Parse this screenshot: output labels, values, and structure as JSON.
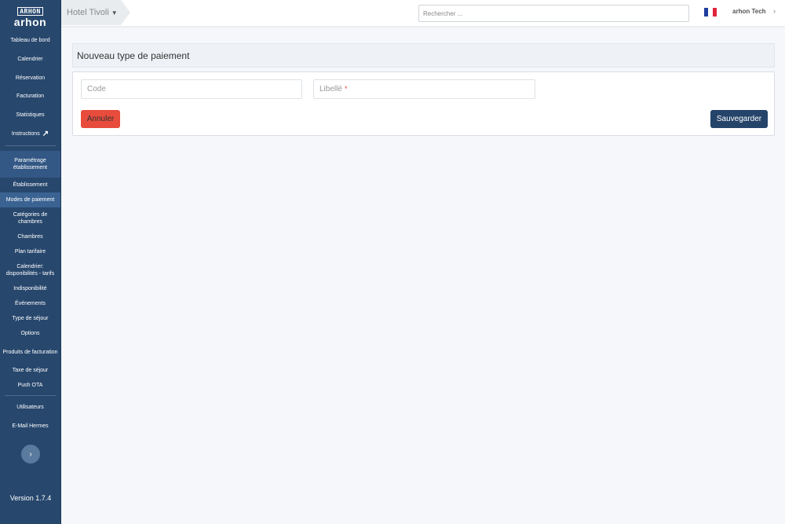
{
  "sidebar": {
    "logo_top": "ARHON",
    "logo_word": "arhon",
    "items_top": [
      {
        "label": "Tableau de bord"
      },
      {
        "label": "Calendrier"
      },
      {
        "label": "Réservation"
      },
      {
        "label": "Facturation"
      },
      {
        "label": "Statistiques"
      },
      {
        "label": "Instructions"
      }
    ],
    "section_label": "Paramétrage établissement",
    "sub_items": [
      {
        "label": "Établissement"
      },
      {
        "label": "Modes de paiement",
        "active": true
      },
      {
        "label": "Catégories de chambres"
      },
      {
        "label": "Chambres"
      },
      {
        "label": "Plan tarifaire"
      },
      {
        "label": "Calendrier: disponibilités - tarifs"
      },
      {
        "label": "Indisponibilité"
      },
      {
        "label": "Événements"
      },
      {
        "label": "Type de séjour"
      },
      {
        "label": "Options"
      },
      {
        "label": "Produits de facturation"
      },
      {
        "label": "Taxe de séjour"
      },
      {
        "label": "Push OTA"
      }
    ],
    "bottom_items": [
      {
        "label": "Utilisateurs"
      },
      {
        "label": "E-Mail Hermes"
      }
    ],
    "collapse_icon": "chevron-right-icon",
    "version": "Version 1.7.4"
  },
  "topbar": {
    "hotel": "Hotel Tivoli",
    "search_placeholder": "Rechercher ...",
    "flag": "french-flag",
    "user": "arhon Tech"
  },
  "page": {
    "title": "Nouveau type de paiement",
    "code_placeholder": "Code",
    "code_value": "",
    "label_placeholder": "Libellé",
    "label_value": "",
    "required_mark": "*",
    "cancel_label": "Annuler",
    "save_label": "Sauvegarder"
  },
  "colors": {
    "sidebar_bg": "#27476d",
    "danger": "#e74c3c",
    "primary": "#25446a",
    "page_bg": "#f5f7fb"
  }
}
